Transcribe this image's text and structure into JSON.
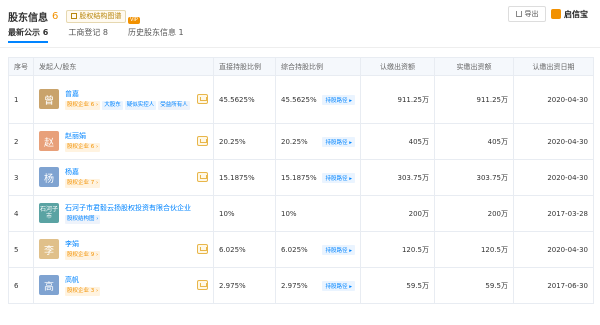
{
  "header": {
    "title": "股东信息",
    "count": "6",
    "structure_btn": "股权结构图谱"
  },
  "toolbar": {
    "export": "导出",
    "brand": "启信宝"
  },
  "tabs": [
    {
      "label": "最新公示 6",
      "active": true
    },
    {
      "label": "工商登记 8",
      "active": false
    },
    {
      "label": "历史股东信息 1",
      "active": false,
      "badge": "VIP"
    }
  ],
  "table": {
    "headers": [
      "序号",
      "发起人/股东",
      "直接持股比例",
      "综合持股比例",
      "认缴出资额",
      "实缴出资额",
      "认缴出资日期"
    ],
    "rows": [
      {
        "index": "1",
        "avatar_text": "曾",
        "avatar_color": "#c9a36b",
        "name": "曾嘉",
        "tags": [
          {
            "text": "股权企业 6 ›",
            "type": "orange"
          },
          {
            "text": "大股东",
            "type": "blue"
          },
          {
            "text": "疑似实控人",
            "type": "blue"
          },
          {
            "text": "受益所有人",
            "type": "gray"
          }
        ],
        "direct": "45.5625%",
        "total": "45.5625%",
        "pen": "持股路径 ▸",
        "subscribed": "911.25万",
        "paid": "911.25万",
        "date": "2020-04-30"
      },
      {
        "index": "2",
        "avatar_text": "赵",
        "avatar_color": "#e8a07a",
        "name": "赵丽娟",
        "tags": [
          {
            "text": "股权企业 6 ›",
            "type": "orange"
          }
        ],
        "direct": "20.25%",
        "total": "20.25%",
        "pen": "持股路径 ▸",
        "subscribed": "405万",
        "paid": "405万",
        "date": "2020-04-30"
      },
      {
        "index": "3",
        "avatar_text": "杨",
        "avatar_color": "#7fa3d1",
        "name": "杨嘉",
        "tags": [
          {
            "text": "股权企业 7 ›",
            "type": "orange"
          }
        ],
        "direct": "15.1875%",
        "total": "15.1875%",
        "pen": "持股路径 ▸",
        "subscribed": "303.75万",
        "paid": "303.75万",
        "date": "2020-04-30"
      },
      {
        "index": "4",
        "avatar_text": "石河子市",
        "avatar_color": "#5aa3a3",
        "name": "石河子市君毅云扬股权投资有限合伙企业",
        "tags": [
          {
            "text": "股权结构图 ›",
            "type": "gray"
          }
        ],
        "direct": "10%",
        "total": "10%",
        "pen": "",
        "subscribed": "200万",
        "paid": "200万",
        "date": "2017-03-28"
      },
      {
        "index": "5",
        "avatar_text": "李",
        "avatar_color": "#e0c08a",
        "name": "李娟",
        "tags": [
          {
            "text": "股权企业 9 ›",
            "type": "orange"
          }
        ],
        "direct": "6.025%",
        "total": "6.025%",
        "pen": "持股路径 ▸",
        "subscribed": "120.5万",
        "paid": "120.5万",
        "date": "2020-04-30"
      },
      {
        "index": "6",
        "avatar_text": "高",
        "avatar_color": "#7fa3d1",
        "name": "高帆",
        "tags": [
          {
            "text": "股权企业 3 ›",
            "type": "orange"
          }
        ],
        "direct": "2.975%",
        "total": "2.975%",
        "pen": "持股路径 ▸",
        "subscribed": "59.5万",
        "paid": "59.5万",
        "date": "2017-06-30"
      }
    ]
  }
}
